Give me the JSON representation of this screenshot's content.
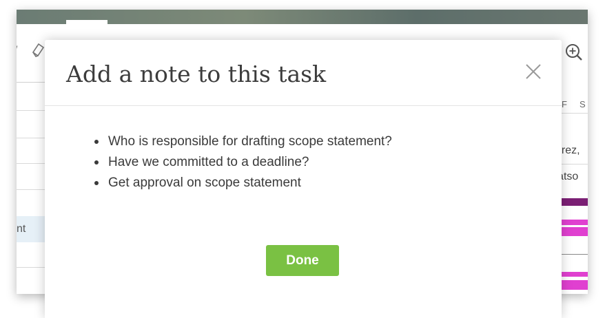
{
  "background": {
    "icons": [
      "pencil-icon",
      "eraser-icon",
      "zoom-in-icon"
    ],
    "left_column": {
      "selected_row_text": "nt"
    },
    "right_column": {
      "day_headers": [
        "F",
        "S"
      ],
      "assignee_fragments": [
        "erez,",
        "'atso"
      ]
    },
    "gantt_colors": [
      "#7b1f74",
      "#e040d0"
    ]
  },
  "modal": {
    "title": "Add a note to this task",
    "close_icon": "close-icon",
    "notes": [
      "Who is responsible for drafting scope statement?",
      "Have we committed to a deadline?",
      "Get approval on scope statement"
    ],
    "done_label": "Done",
    "done_color": "#7ac143"
  }
}
